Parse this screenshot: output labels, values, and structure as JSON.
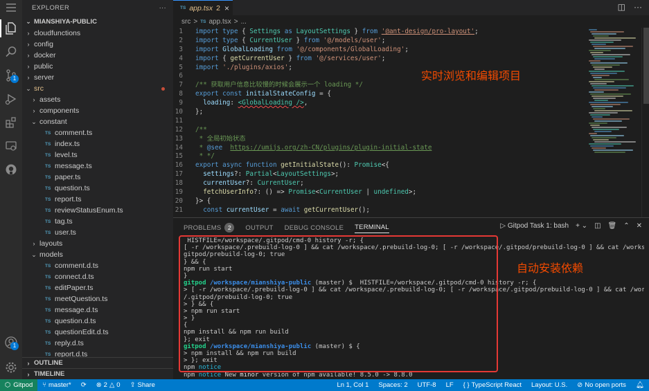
{
  "sidebar": {
    "title": "EXPLORER",
    "more": "···",
    "root": "MIANSHIYA-PUBLIC",
    "items": [
      {
        "label": "cloudfunctions",
        "type": "folder",
        "depth": 1
      },
      {
        "label": "config",
        "type": "folder",
        "depth": 1
      },
      {
        "label": "docker",
        "type": "folder",
        "depth": 1
      },
      {
        "label": "public",
        "type": "folder",
        "depth": 1
      },
      {
        "label": "server",
        "type": "folder",
        "depth": 1
      },
      {
        "label": "src",
        "type": "folder-open",
        "depth": 1,
        "modified": true
      },
      {
        "label": "assets",
        "type": "folder",
        "depth": 2
      },
      {
        "label": "components",
        "type": "folder",
        "depth": 2
      },
      {
        "label": "constant",
        "type": "folder-open",
        "depth": 2
      },
      {
        "label": "comment.ts",
        "type": "file",
        "depth": 3
      },
      {
        "label": "index.ts",
        "type": "file",
        "depth": 3
      },
      {
        "label": "level.ts",
        "type": "file",
        "depth": 3
      },
      {
        "label": "message.ts",
        "type": "file",
        "depth": 3
      },
      {
        "label": "paper.ts",
        "type": "file",
        "depth": 3
      },
      {
        "label": "question.ts",
        "type": "file",
        "depth": 3
      },
      {
        "label": "report.ts",
        "type": "file",
        "depth": 3
      },
      {
        "label": "reviewStatusEnum.ts",
        "type": "file",
        "depth": 3
      },
      {
        "label": "tag.ts",
        "type": "file",
        "depth": 3
      },
      {
        "label": "user.ts",
        "type": "file",
        "depth": 3
      },
      {
        "label": "layouts",
        "type": "folder",
        "depth": 2
      },
      {
        "label": "models",
        "type": "folder-open",
        "depth": 2
      },
      {
        "label": "comment.d.ts",
        "type": "file",
        "depth": 3
      },
      {
        "label": "connect.d.ts",
        "type": "file",
        "depth": 3
      },
      {
        "label": "editPaper.ts",
        "type": "file",
        "depth": 3
      },
      {
        "label": "meetQuestion.ts",
        "type": "file",
        "depth": 3
      },
      {
        "label": "message.d.ts",
        "type": "file",
        "depth": 3
      },
      {
        "label": "question.d.ts",
        "type": "file",
        "depth": 3
      },
      {
        "label": "questionEdit.d.ts",
        "type": "file",
        "depth": 3
      },
      {
        "label": "reply.d.ts",
        "type": "file",
        "depth": 3
      },
      {
        "label": "report.d.ts",
        "type": "file",
        "depth": 3
      }
    ],
    "outline": "OUTLINE",
    "timeline": "TIMELINE",
    "accounts_badge": "1"
  },
  "tab": {
    "icon": "TS",
    "name": "app.tsx",
    "problems": "2",
    "close": "×"
  },
  "breadcrumb": {
    "folder": "src",
    "sep": ">",
    "icon": "TS",
    "file": "app.tsx",
    "more": "..."
  },
  "editor": {
    "line_numbers": [
      "1",
      "2",
      "3",
      "4",
      "5",
      "6",
      "7",
      "8",
      "9",
      "10",
      "11",
      "12",
      "13",
      "14",
      "15",
      "16",
      "17",
      "18",
      "19",
      "20",
      "21"
    ],
    "annotation": "实时浏览和编辑项目"
  },
  "panel": {
    "tabs": [
      "PROBLEMS",
      "OUTPUT",
      "DEBUG CONSOLE",
      "TERMINAL"
    ],
    "problems_count": "2",
    "terminal_name": "Gitpod Task 1: bash",
    "annotation": "自动安装依赖",
    "terminal_lines": [
      [
        {
          "t": " HISTFILE=/workspace/.gitpod/cmd-0 history -r; {"
        }
      ],
      [
        {
          "t": "[ -r /workspace/.prebuild-log-0 ] && cat /workspace/.prebuild-log-0; [ -r /workspace/.gitpod/prebuild-log-0 ] && cat /workspace/."
        }
      ],
      [
        {
          "t": "gitpod/prebuild-log-0; true"
        }
      ],
      [
        {
          "t": "} && {"
        }
      ],
      [
        {
          "t": "npm run start"
        }
      ],
      [
        {
          "t": "}"
        }
      ],
      [
        {
          "t": "gitpod ",
          "c": "g"
        },
        {
          "t": "/workspace/mianshiya-public",
          "c": "b"
        },
        {
          "t": " (master) $  HISTFILE=/workspace/.gitpod/cmd-0 history -r; {"
        }
      ],
      [
        {
          "t": "> [ -r /workspace/.prebuild-log-0 ] && cat /workspace/.prebuild-log-0; [ -r /workspace/.gitpod/prebuild-log-0 ] && cat /workspace"
        }
      ],
      [
        {
          "t": "/.gitpod/prebuild-log-0; true"
        }
      ],
      [
        {
          "t": "> } && {"
        }
      ],
      [
        {
          "t": "> npm run start"
        }
      ],
      [
        {
          "t": "> }"
        }
      ],
      [
        {
          "t": "{"
        }
      ],
      [
        {
          "t": "npm install && npm run build"
        }
      ],
      [
        {
          "t": "}; exit"
        }
      ],
      [
        {
          "t": "gitpod ",
          "c": "g"
        },
        {
          "t": "/workspace/mianshiya-public",
          "c": "b"
        },
        {
          "t": " (master) $ {"
        }
      ],
      [
        {
          "t": "> npm install && npm run build"
        }
      ],
      [
        {
          "t": "> }; exit"
        }
      ],
      [
        {
          "t": "npm "
        },
        {
          "t": "notice",
          "c": "c"
        }
      ],
      [
        {
          "t": "npm "
        },
        {
          "t": "notice",
          "c": "c"
        },
        {
          "t": " New "
        },
        {
          "t": "minor",
          "c": "w"
        },
        {
          "t": " version of npm available! 8.5.0 -> 8.8.0"
        }
      ]
    ]
  },
  "statusbar": {
    "remote": "Gitpod",
    "branch": "master*",
    "errors": "2",
    "warnings": "0",
    "share": "Share",
    "position": "Ln 1, Col 1",
    "spaces": "Spaces: 2",
    "encoding": "UTF-8",
    "eol": "LF",
    "language": "TypeScript React",
    "layout": "Layout: U.S.",
    "ports": "No open ports"
  },
  "colors": {
    "accent": "#007acc",
    "remote": "#16825d",
    "annotation": "#f54b00",
    "highlight_box": "#e53935"
  }
}
